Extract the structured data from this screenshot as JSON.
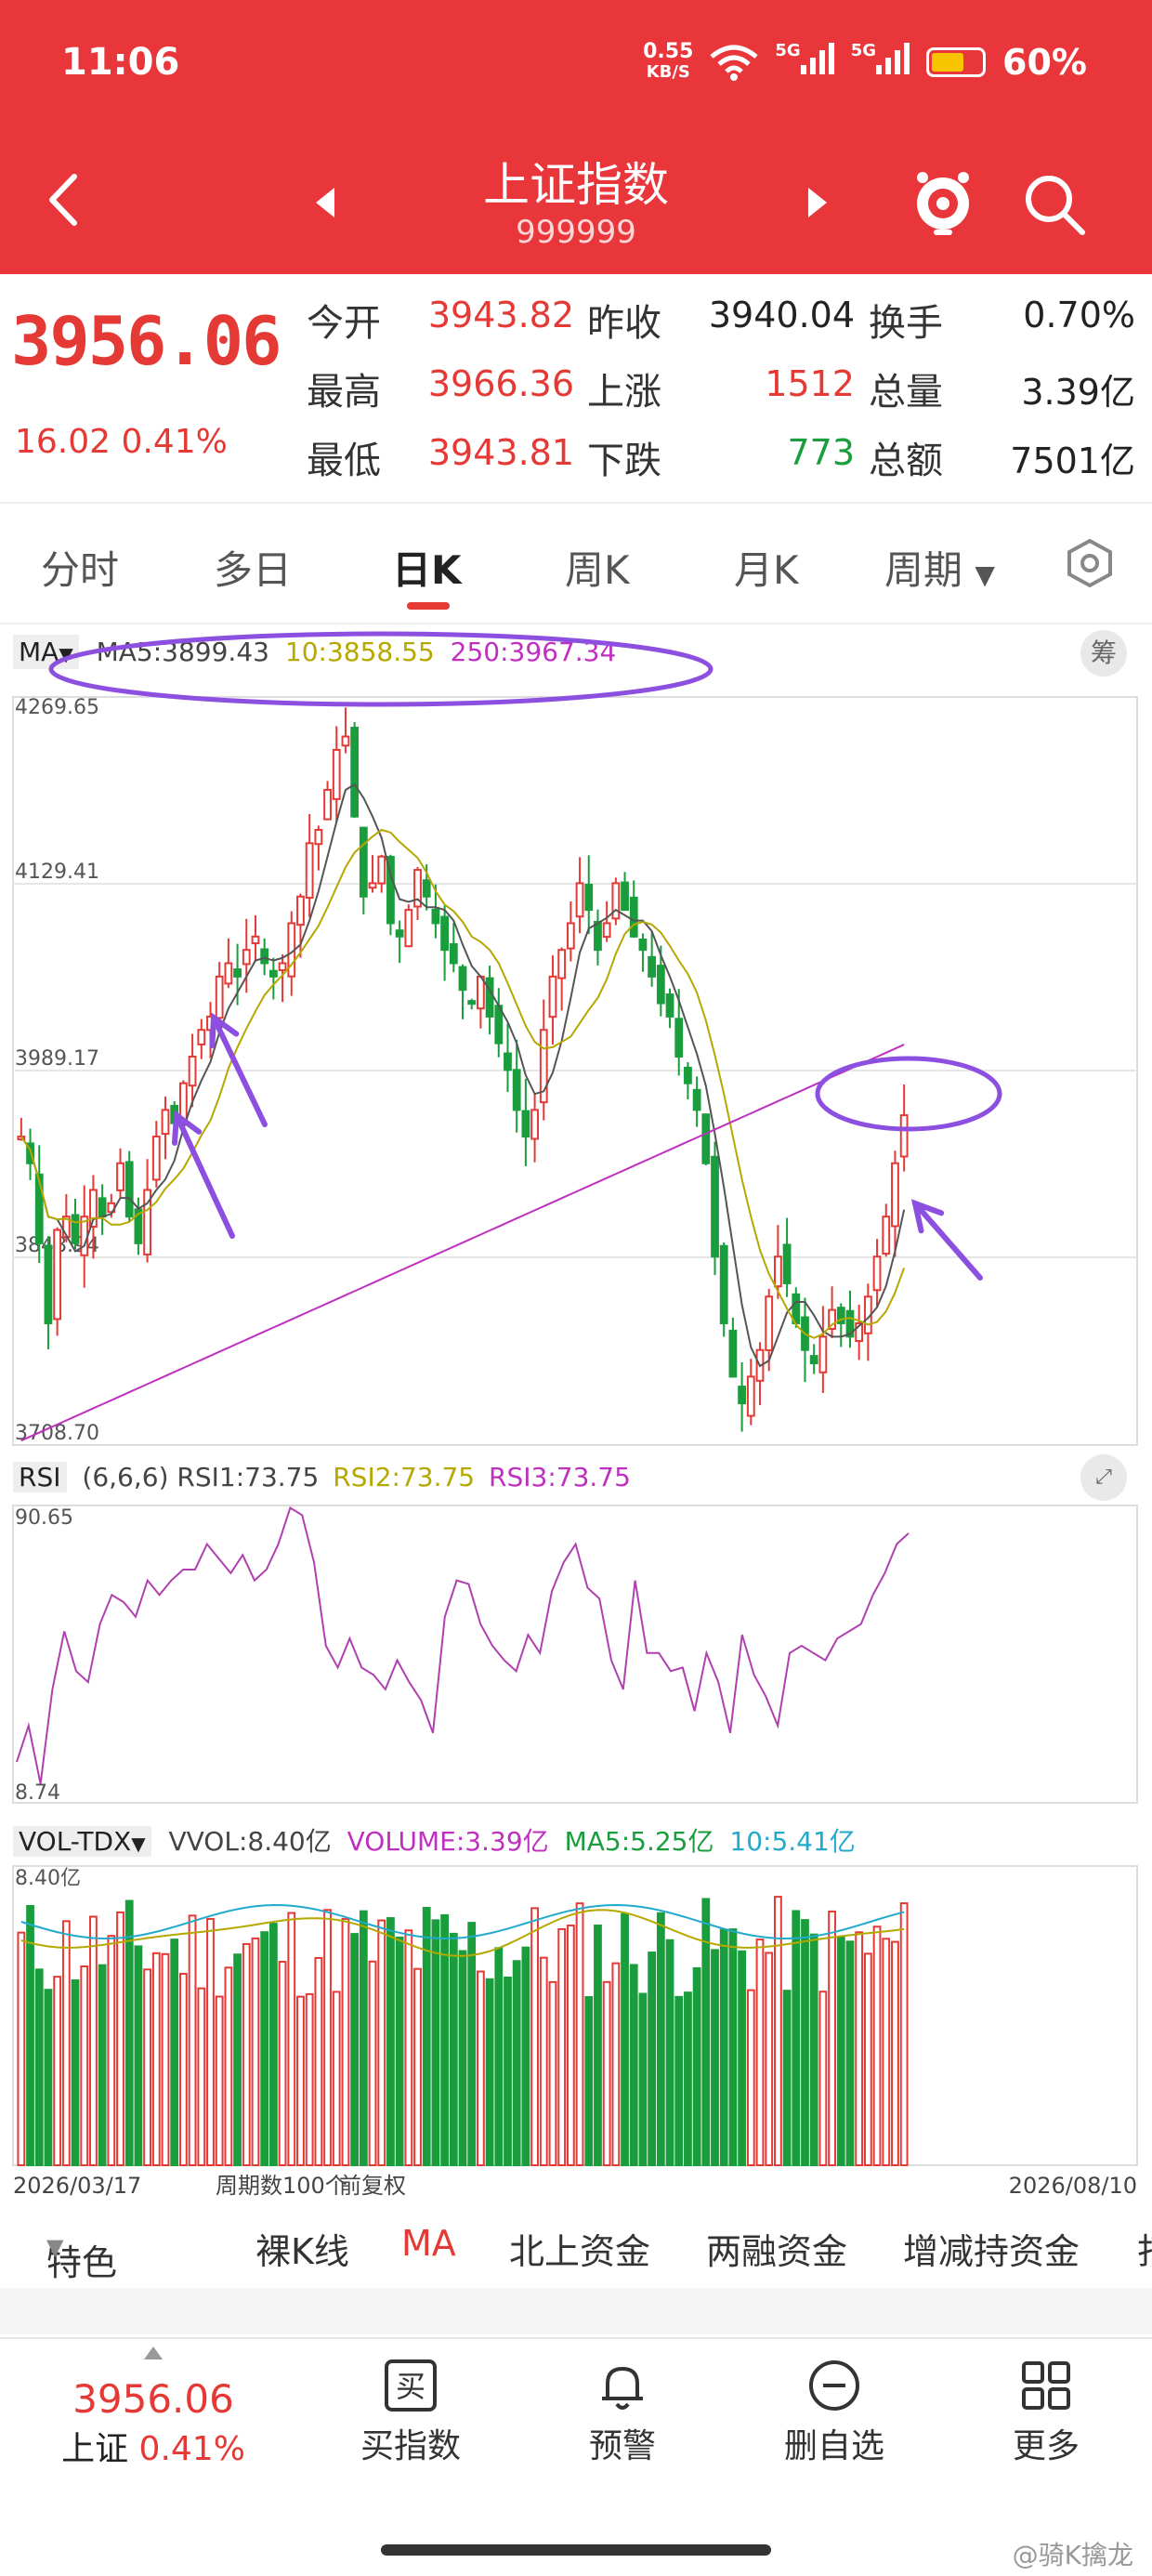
{
  "status": {
    "time": "11:06",
    "net_speed": "0.55",
    "net_unit": "KB/S",
    "signal1": "5G",
    "signal2": "5G",
    "battery": "60%"
  },
  "header": {
    "title": "上证指数",
    "code": "999999"
  },
  "quote": {
    "price": "3956.06",
    "change": "16.02",
    "change_pct": "0.41%",
    "fields": [
      {
        "label": "今开",
        "value": "3943.82",
        "color": "red"
      },
      {
        "label": "昨收",
        "value": "3940.04",
        "color": "black"
      },
      {
        "label": "换手",
        "value": "0.70%",
        "color": "black"
      },
      {
        "label": "最高",
        "value": "3966.36",
        "color": "red"
      },
      {
        "label": "上涨",
        "value": "1512",
        "color": "red"
      },
      {
        "label": "总量",
        "value": "3.39亿",
        "color": "black"
      },
      {
        "label": "最低",
        "value": "3943.81",
        "color": "red"
      },
      {
        "label": "下跌",
        "value": "773",
        "color": "green"
      },
      {
        "label": "总额",
        "value": "7501亿",
        "color": "black"
      }
    ]
  },
  "tabs": [
    "分时",
    "多日",
    "日K",
    "周K",
    "月K",
    "周期"
  ],
  "active_tab": "日K",
  "main_chart": {
    "ma_label": "MA",
    "ma5": "MA5:3899.43",
    "ma10": "10:3858.55",
    "ma250": "250:3967.34",
    "chip_button": "筹",
    "y_labels": [
      "4269.65",
      "4129.41",
      "3989.17",
      "3848.94",
      "3708.70"
    ]
  },
  "rsi": {
    "name": "RSI",
    "params": "(6,6,6)",
    "rsi1": "RSI1:73.75",
    "rsi2": "RSI2:73.75",
    "rsi3": "RSI3:73.75",
    "max": "90.65",
    "min": "8.74"
  },
  "vol": {
    "name": "VOL-TDX",
    "vvol": "VVOL:8.40亿",
    "volume": "VOLUME:3.39亿",
    "ma5": "MA5:5.25亿",
    "ma10": "10:5.41亿",
    "max": "8.40亿"
  },
  "footer_axis": {
    "start": "2026/03/17",
    "count": "周期数100个",
    "adjust": "前复权",
    "end": "2026/08/10"
  },
  "bottom_tabs": [
    "特色",
    "裸K线",
    "MA",
    "北上资金",
    "两融资金",
    "增减持资金",
    "打"
  ],
  "nav": {
    "price": "3956.06",
    "name": "上证",
    "pct": "0.41%",
    "items": [
      "买指数",
      "预警",
      "删自选",
      "更多"
    ],
    "buy_glyph": "买"
  },
  "watermark": "@骑K擒龙",
  "chart_data": {
    "type": "candlestick",
    "ylim": [
      3708.7,
      4269.65
    ],
    "close": [
      3940,
      3920,
      3860,
      3800,
      3870,
      3880,
      3860,
      3880,
      3900,
      3880,
      3890,
      3920,
      3880,
      3860,
      3900,
      3940,
      3960,
      3950,
      3980,
      4000,
      4020,
      4030,
      4060,
      4070,
      4060,
      4080,
      4090,
      4070,
      4060,
      4070,
      4100,
      4120,
      4160,
      4170,
      4200,
      4230,
      4240,
      4180,
      4120,
      4130,
      4150,
      4100,
      4090,
      4110,
      4140,
      4120,
      4100,
      4080,
      4070,
      4050,
      4040,
      4060,
      4030,
      4010,
      3990,
      3960,
      3940,
      3960,
      4020,
      4060,
      4080,
      4100,
      4130,
      4110,
      4080,
      4100,
      4130,
      4110,
      4090,
      4080,
      4060,
      4040,
      4030,
      4000,
      3980,
      3960,
      3920,
      3850,
      3800,
      3760,
      3740,
      3760,
      3780,
      3820,
      3850,
      3830,
      3800,
      3780,
      3770,
      3790,
      3810,
      3800,
      3790,
      3800,
      3820,
      3850,
      3880,
      3920,
      3956
    ],
    "rsi": [
      20,
      30,
      14,
      40,
      56,
      45,
      42,
      58,
      66,
      64,
      60,
      70,
      66,
      70,
      73,
      73,
      80,
      76,
      72,
      77,
      70,
      73,
      80,
      90,
      88,
      75,
      52,
      46,
      54,
      46,
      44,
      40,
      48,
      42,
      37,
      28,
      60,
      70,
      69,
      58,
      52,
      48,
      45,
      55,
      50,
      67,
      75,
      80,
      68,
      65,
      48,
      40,
      70,
      50,
      50,
      45,
      46,
      34,
      50,
      42,
      28,
      55,
      44,
      38,
      30,
      50,
      52,
      50,
      48,
      54,
      56,
      58,
      66,
      72,
      80,
      83
    ],
    "volume_trend": "mixed red/green bars"
  }
}
